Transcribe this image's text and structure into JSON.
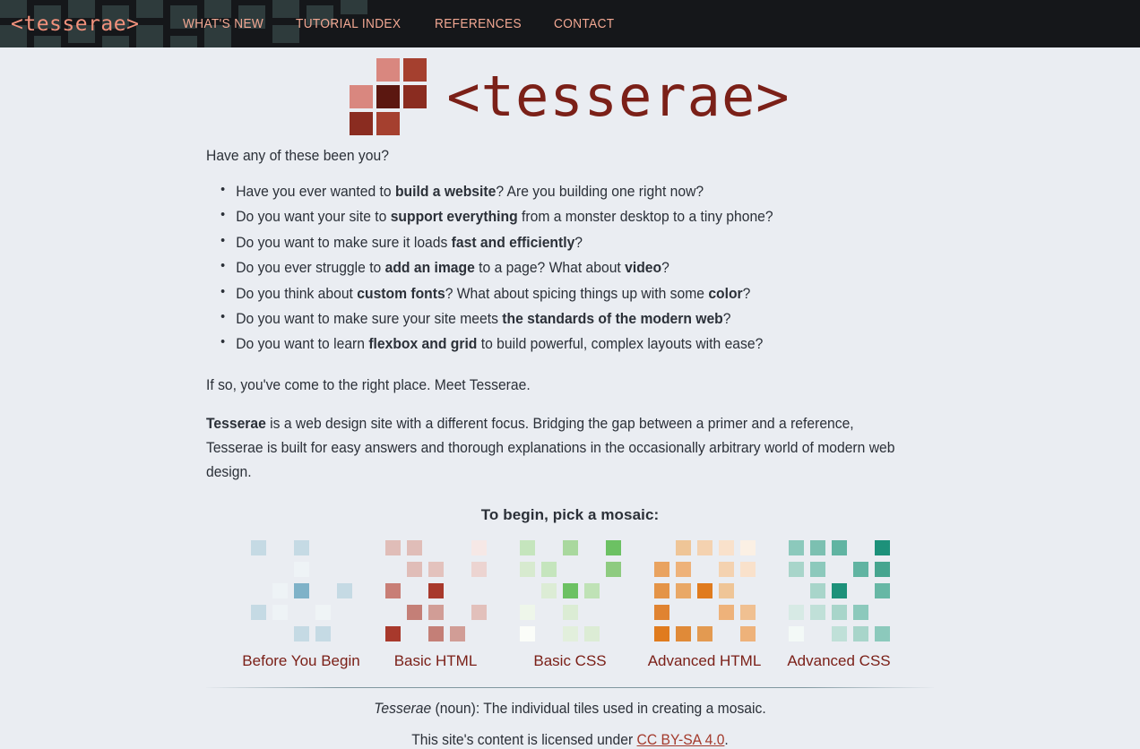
{
  "nav": {
    "brand": "<tesserae>",
    "links": [
      {
        "label": "WHAT'S NEW",
        "name": "nav-link-whats-new"
      },
      {
        "label": "TUTORIAL INDEX",
        "name": "nav-link-tutorial-index"
      },
      {
        "label": "REFERENCES",
        "name": "nav-link-references"
      },
      {
        "label": "CONTACT",
        "name": "nav-link-contact"
      }
    ],
    "background_color": "#15171a",
    "tile_color": "#2e3b3c",
    "brand_color": "#f2917c",
    "link_color": "#f3a893"
  },
  "logo": {
    "wordmark": "<tesserae>",
    "wordmark_color": "#7b2018",
    "mosaic_colors": [
      "transparent",
      "#d9877f",
      "#a5402f",
      "#d9877f",
      "#5b1710",
      "#8a2c20",
      "#8a2c20",
      "#a5402f",
      "transparent"
    ]
  },
  "intro": {
    "lead": "Have any of these been you?",
    "questions": [
      {
        "pre": "Have you ever wanted to ",
        "bold": "build a website",
        "post": "? Are you building one right now?"
      },
      {
        "pre": "Do you want your site to ",
        "bold": "support everything",
        "post": " from a monster desktop to a tiny phone?"
      },
      {
        "pre": "Do you want to make sure it loads ",
        "bold": "fast and efficiently",
        "post": "?"
      },
      {
        "pre": "Do you ever struggle to ",
        "bold": "add an image",
        "post": " to a page? What about ",
        "bold2": "video",
        "post2": "?"
      },
      {
        "pre": "Do you think about ",
        "bold": "custom fonts",
        "post": "? What about spicing things up with some ",
        "bold2": "color",
        "post2": "?"
      },
      {
        "pre": "Do you want to make sure your site meets ",
        "bold": "the standards of the modern web",
        "post": "?"
      },
      {
        "pre": "Do you want to learn ",
        "bold": "flexbox and grid",
        "post": " to build powerful, complex layouts with ease?"
      }
    ],
    "closing": "If so, you've come to the right place. Meet Tesserae.",
    "about_bold": "Tesserae",
    "about_rest": " is a web design site with a different focus. Bridging the gap between a primer and a reference, Tesserae is built for easy answers and thorough explanations in the occasionally arbitrary world of modern web design."
  },
  "picker": {
    "heading": "To begin, pick a mosaic:",
    "cards": [
      {
        "label": "Before You Begin",
        "name": "mosaic-card-before-you-begin",
        "accent": "#7fb2c8",
        "tiles": [
          "#c5dae4",
          "",
          "#c5dae4",
          "",
          "",
          "",
          "",
          "#eef3f6",
          "",
          "",
          "",
          "#eef3f6",
          "#7fb2c8",
          "",
          "#c5dae4",
          "#c5dae4",
          "#eef3f6",
          "",
          "#eff4f6",
          "",
          "",
          "",
          "#c5dae4",
          "#c5dae4",
          ""
        ]
      },
      {
        "label": "Basic HTML",
        "name": "mosaic-card-basic-html",
        "accent": "#a8392c",
        "tiles": [
          "#e0bdb8",
          "#e0bdb8",
          "",
          "",
          "#f6e8e6",
          "",
          "#e0bdb8",
          "#e3c2bd",
          "",
          "#ecd4d1",
          "#c87e76",
          "",
          "#a8392c",
          "",
          "",
          "",
          "#c47f77",
          "#d19d96",
          "",
          "#e2c0bb",
          "#a8392c",
          "",
          "#c47f77",
          "#d19d96",
          ""
        ]
      },
      {
        "label": "Basic CSS",
        "name": "mosaic-card-basic-css",
        "accent": "#6cc163",
        "tiles": [
          "#c5e5bd",
          "",
          "#a9d89e",
          "",
          "#6cc163",
          "#d7eacf",
          "#c5e5bd",
          "",
          "",
          "#8ecb80",
          "",
          "#dcecd5",
          "#6cc163",
          "#bfe2b6",
          "",
          "#eef6ea",
          "",
          "#dbecd4",
          "",
          "",
          "#fbfdf9",
          "",
          "#e2efdc",
          "#dcecd5",
          ""
        ]
      },
      {
        "label": "Advanced HTML",
        "name": "mosaic-card-advanced-html",
        "accent": "#e07b1e",
        "tiles": [
          "",
          "#efc597",
          "#f4d2b0",
          "#f9e1cb",
          "#fbf0e4",
          "#e9a360",
          "#eeb27a",
          "",
          "#f4d2b0",
          "#f9e1cb",
          "#e49448",
          "#e9a867",
          "#e07b1e",
          "#efc597",
          "",
          "#e08331",
          "",
          "",
          "#eeb27a",
          "#f0c091",
          "#e07b1e",
          "#e08a38",
          "#e39a51",
          "",
          "#eeb27a"
        ]
      },
      {
        "label": "Advanced CSS",
        "name": "mosaic-card-advanced-css",
        "accent": "#1d917a",
        "tiles": [
          "#8cc9bc",
          "#7cc0b1",
          "#61b4a2",
          "",
          "#1d917a",
          "#a8d5ca",
          "#8cc9bc",
          "",
          "#61b4a2",
          "#46a58f",
          "",
          "#a8d5ca",
          "#1d917a",
          "",
          "#67b7a5",
          "#d7eae5",
          "#c0e0d8",
          "#a8d5ca",
          "#8cc9bc",
          "",
          "#f3f9f7",
          "",
          "#c0e0d8",
          "#a8d5ca",
          "#8cc9bc"
        ]
      }
    ]
  },
  "footer": {
    "definition_term": "Tesserae",
    "definition_rest": " (noun): The individual tiles used in creating a mosaic.",
    "license_pre": "This site's content is licensed under ",
    "license_link": "CC BY-SA 4.0",
    "license_post": ".",
    "link_color": "#a33a2c"
  }
}
